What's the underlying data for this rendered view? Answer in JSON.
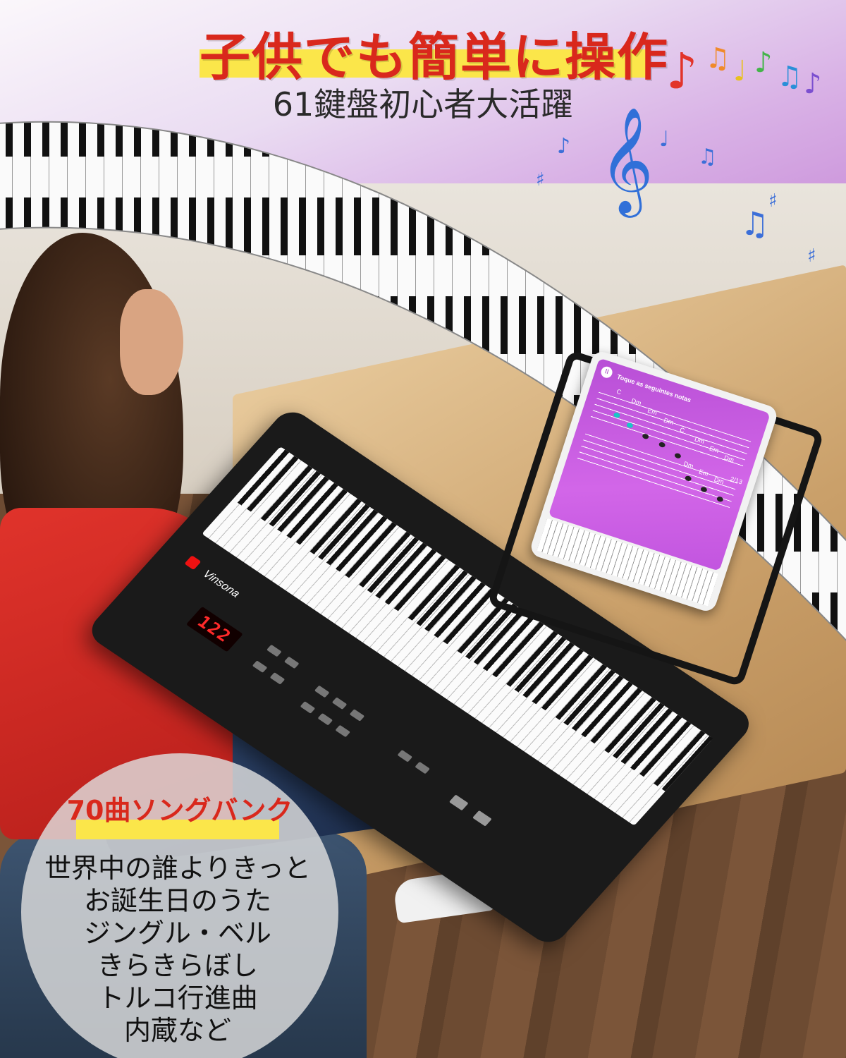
{
  "headline": "子供でも簡単に操作",
  "subheadline": "61鍵盤初心者大活躍",
  "badge": {
    "title": "70曲ソングバンク",
    "songs": [
      "世界中の誰よりきっと",
      "お誕生日のうた",
      "ジングル・ベル",
      "きらきらぼし",
      "トルコ行進曲",
      "内蔵など"
    ]
  },
  "keyboard": {
    "brand": "Vinsona",
    "display": "122"
  },
  "tablet": {
    "title": "Toque as seguintes notas",
    "page": "2/13",
    "chords_top": [
      "C",
      "Dm",
      "Em",
      "Dm",
      "C",
      "Dm",
      "Em",
      "Dm"
    ],
    "chords_bottom": [
      "Dm",
      "Em",
      "Dm"
    ]
  },
  "colors": {
    "headline_red": "#d9281c",
    "highlight_yellow": "#fbe64a",
    "keyboard_body": "#1a1a1a",
    "tablet_screen": "#c255df"
  }
}
